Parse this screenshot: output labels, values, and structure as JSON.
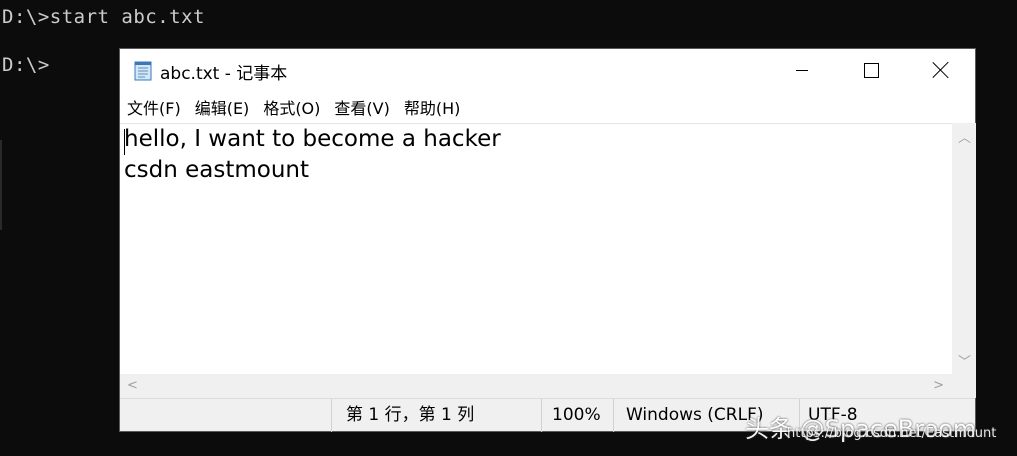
{
  "console": {
    "line1": "D:\\>start abc.txt",
    "line2": "D:\\>"
  },
  "window": {
    "title": "abc.txt - 记事本",
    "icon": "notepad-icon",
    "controls": [
      "minimize-icon",
      "maximize-icon",
      "close-icon"
    ]
  },
  "menu": [
    {
      "label": "文件(F)"
    },
    {
      "label": "编辑(E)"
    },
    {
      "label": "格式(O)"
    },
    {
      "label": "查看(V)"
    },
    {
      "label": "帮助(H)"
    }
  ],
  "editor": {
    "lines": [
      "hello, I want to become a hacker",
      "csdn eastmount"
    ]
  },
  "status": {
    "position": "第 1 行，第 1 列",
    "zoom": "100%",
    "line_ending": "Windows (CRLF)",
    "encoding": "UTF-8"
  },
  "watermark": {
    "brand": "头条 @SpaceBroom",
    "url": "https://blog.csdn.net/Eastmount"
  }
}
